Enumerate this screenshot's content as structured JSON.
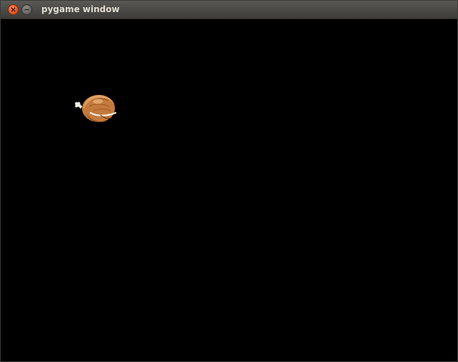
{
  "window": {
    "title": "pygame window",
    "controls": {
      "close_icon": "close-icon",
      "minimize_icon": "minimize-icon"
    }
  },
  "game": {
    "background_color": "#000000",
    "sprite": {
      "icon": "roast-chicken-sprite",
      "colors": {
        "body": "#c47a3c",
        "highlight": "#e0a062",
        "shadow": "#8a4a1c",
        "bone": "#f2f0ea"
      }
    }
  }
}
